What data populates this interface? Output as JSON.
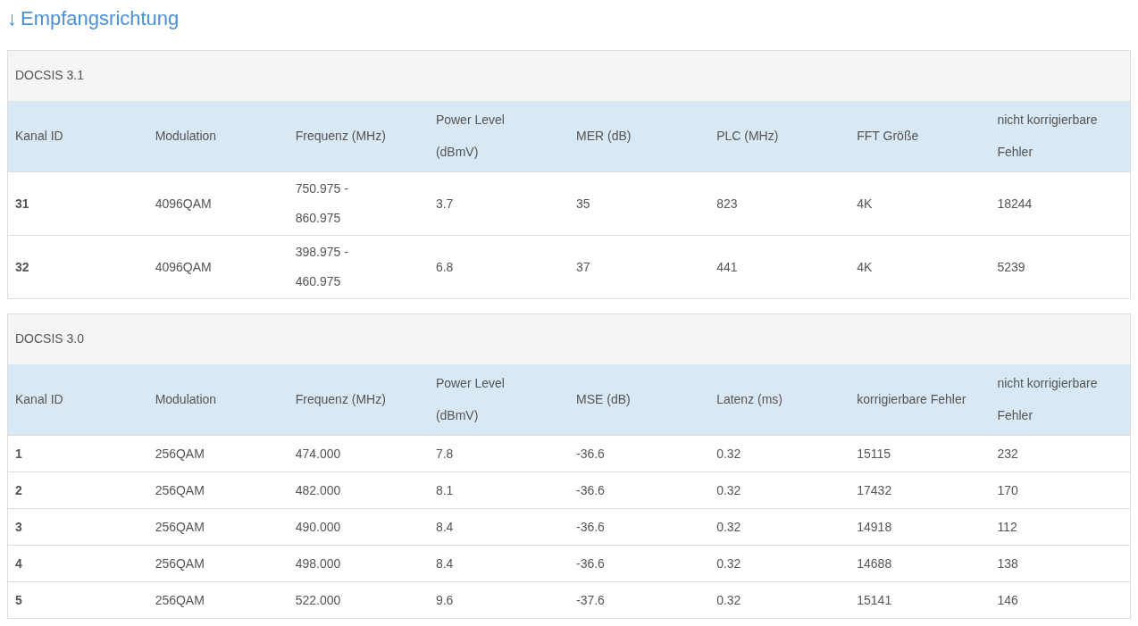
{
  "heading": {
    "arrow": "↓",
    "title": "Empfangsrichtung"
  },
  "sections": [
    {
      "title": "DOCSIS 3.1",
      "columns": [
        "Kanal ID",
        "Modulation",
        "Frequenz (MHz)",
        "Power Level (dBmV)",
        "MER (dB)",
        "PLC (MHz)",
        "FFT Größe",
        "nicht korrigierbare Fehler"
      ],
      "rows": [
        [
          "31",
          "4096QAM",
          "750.975 - 860.975",
          "3.7",
          "35",
          "823",
          "4K",
          "18244"
        ],
        [
          "32",
          "4096QAM",
          "398.975 - 460.975",
          "6.8",
          "37",
          "441",
          "4K",
          "5239"
        ]
      ]
    },
    {
      "title": "DOCSIS 3.0",
      "columns": [
        "Kanal ID",
        "Modulation",
        "Frequenz (MHz)",
        "Power Level (dBmV)",
        "MSE (dB)",
        "Latenz (ms)",
        "korrigierbare Fehler",
        "nicht korrigierbare Fehler"
      ],
      "rows": [
        [
          "1",
          "256QAM",
          "474.000",
          "7.8",
          "-36.6",
          "0.32",
          "15115",
          "232"
        ],
        [
          "2",
          "256QAM",
          "482.000",
          "8.1",
          "-36.6",
          "0.32",
          "17432",
          "170"
        ],
        [
          "3",
          "256QAM",
          "490.000",
          "8.4",
          "-36.6",
          "0.32",
          "14918",
          "112"
        ],
        [
          "4",
          "256QAM",
          "498.000",
          "8.4",
          "-36.6",
          "0.32",
          "14688",
          "138"
        ],
        [
          "5",
          "256QAM",
          "522.000",
          "9.6",
          "-37.6",
          "0.32",
          "15141",
          "146"
        ]
      ]
    }
  ]
}
